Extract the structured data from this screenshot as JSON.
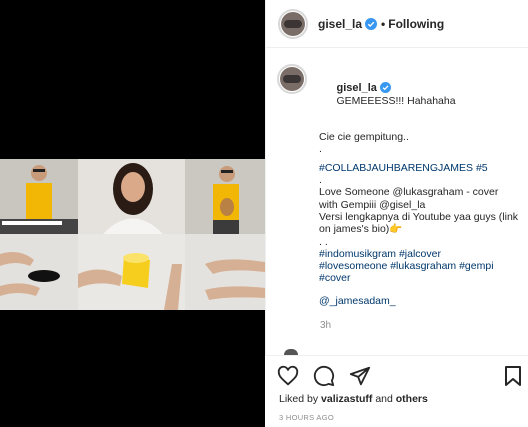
{
  "header": {
    "username": "gisel_la",
    "separator": "•",
    "follow_status": "Following"
  },
  "caption": {
    "username": "gisel_la",
    "first_text": "GEMEEESS!!! Hahahaha",
    "lines": [
      "Cie cie gempitung..",
      ".",
      "#COLLABJAUHBARENGJAMES #5",
      ".",
      "Love Someone @lukasgraham - cover with Gempiii @gisel_la",
      "Versi lengkapnya di Youtube yaa guys (link on james's bio)👉",
      ". .",
      "#indomusikgram #jalcover",
      "#lovesomeone #lukasgraham #gempi",
      "#cover",
      "",
      "@_jamesadam_"
    ],
    "time": "3h"
  },
  "actions": {
    "liked_by_prefix": "Liked by",
    "liked_by_user": "valizastuff",
    "liked_by_and": "and",
    "liked_by_others": "others",
    "posted_ago": "3 HOURS AGO"
  },
  "icons": {
    "like": "heart-icon",
    "comment": "comment-icon",
    "share": "send-icon",
    "save": "bookmark-icon",
    "verified": "verified-badge-icon"
  },
  "colors": {
    "link": "#00376b",
    "verified": "#3897f0",
    "muted": "#8e8e8e",
    "text": "#262626"
  }
}
